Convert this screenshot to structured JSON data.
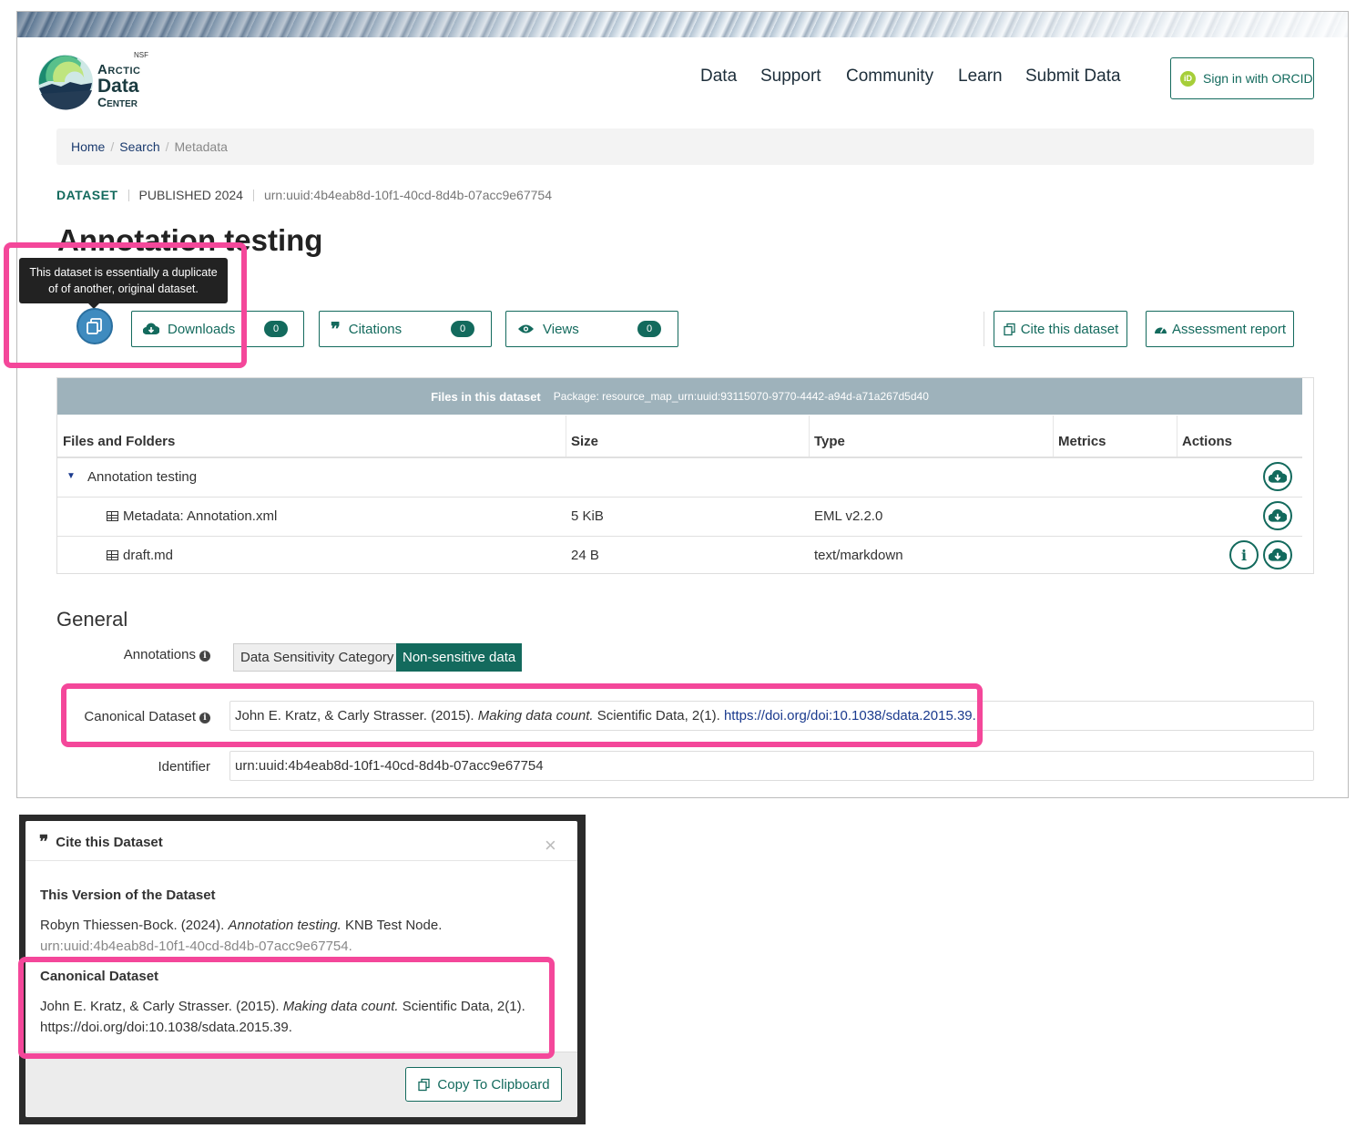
{
  "logo": {
    "nsf": "NSF",
    "line1": "Arctic",
    "line2": "Data",
    "line3": "Center"
  },
  "nav": {
    "items": [
      "Data",
      "Support",
      "Community",
      "Learn",
      "Submit Data"
    ],
    "signin": "Sign in with ORCID",
    "orcid_mark": "iD"
  },
  "breadcrumb": {
    "home": "Home",
    "search": "Search",
    "current": "Metadata",
    "sep": "/"
  },
  "meta": {
    "type": "DATASET",
    "published": "PUBLISHED 2024",
    "id": "urn:uuid:4b4eab8d-10f1-40cd-8d4b-07acc9e67754"
  },
  "title": "Annotation testing",
  "tooltip": {
    "line1": "This dataset is essentially a duplicate",
    "line2": "of of another, original dataset."
  },
  "metrics": {
    "downloads": {
      "label": "Downloads",
      "count": "0"
    },
    "citations": {
      "label": "Citations",
      "count": "0"
    },
    "views": {
      "label": "Views",
      "count": "0"
    }
  },
  "actions": {
    "cite": "Cite this dataset",
    "assessment": "Assessment report"
  },
  "files": {
    "header_title": "Files in this dataset",
    "package": "Package: resource_map_urn:uuid:93115070-9770-4442-a94d-a71a267d5d40",
    "columns": [
      "Files and Folders",
      "Size",
      "Type",
      "Metrics",
      "Actions"
    ],
    "folder": "Annotation testing",
    "rows": [
      {
        "name": "Metadata: Annotation.xml",
        "size": "5 KiB",
        "type": "EML v2.2.0"
      },
      {
        "name": "draft.md",
        "size": "24 B",
        "type": "text/markdown"
      }
    ]
  },
  "general": {
    "heading": "General",
    "annotations_label": "Annotations",
    "annotation_category": "Data Sensitivity Category",
    "annotation_value": "Non-sensitive data",
    "canonical_label": "Canonical Dataset",
    "canonical_text": "John E. Kratz, & Carly Strasser. (2015).",
    "canonical_title": "Making data count.",
    "canonical_journal": "Scientific Data, 2(1).",
    "canonical_doi": "https://doi.org/doi:10.1038/sdata.2015.39.",
    "identifier_label": "Identifier",
    "identifier_value": "urn:uuid:4b4eab8d-10f1-40cd-8d4b-07acc9e67754"
  },
  "modal": {
    "title": "Cite this Dataset",
    "close": "×",
    "version_heading": "This Version of the Dataset",
    "version_authors": "Robyn Thiessen-Bock. (2024).",
    "version_title": "Annotation testing.",
    "version_repo": "KNB Test Node.",
    "version_id": "urn:uuid:4b4eab8d-10f1-40cd-8d4b-07acc9e67754.",
    "canonical_heading": "Canonical Dataset",
    "canonical_authors": "John E. Kratz, & Carly Strasser. (2015).",
    "canonical_title": "Making data count.",
    "canonical_journal": "Scientific Data, 2(1).",
    "canonical_doi": "https://doi.org/doi:10.1038/sdata.2015.39.",
    "copy": "Copy To Clipboard"
  },
  "colors": {
    "accent": "#136a5d",
    "highlight": "#f4479a",
    "link": "#1a3a8e"
  }
}
